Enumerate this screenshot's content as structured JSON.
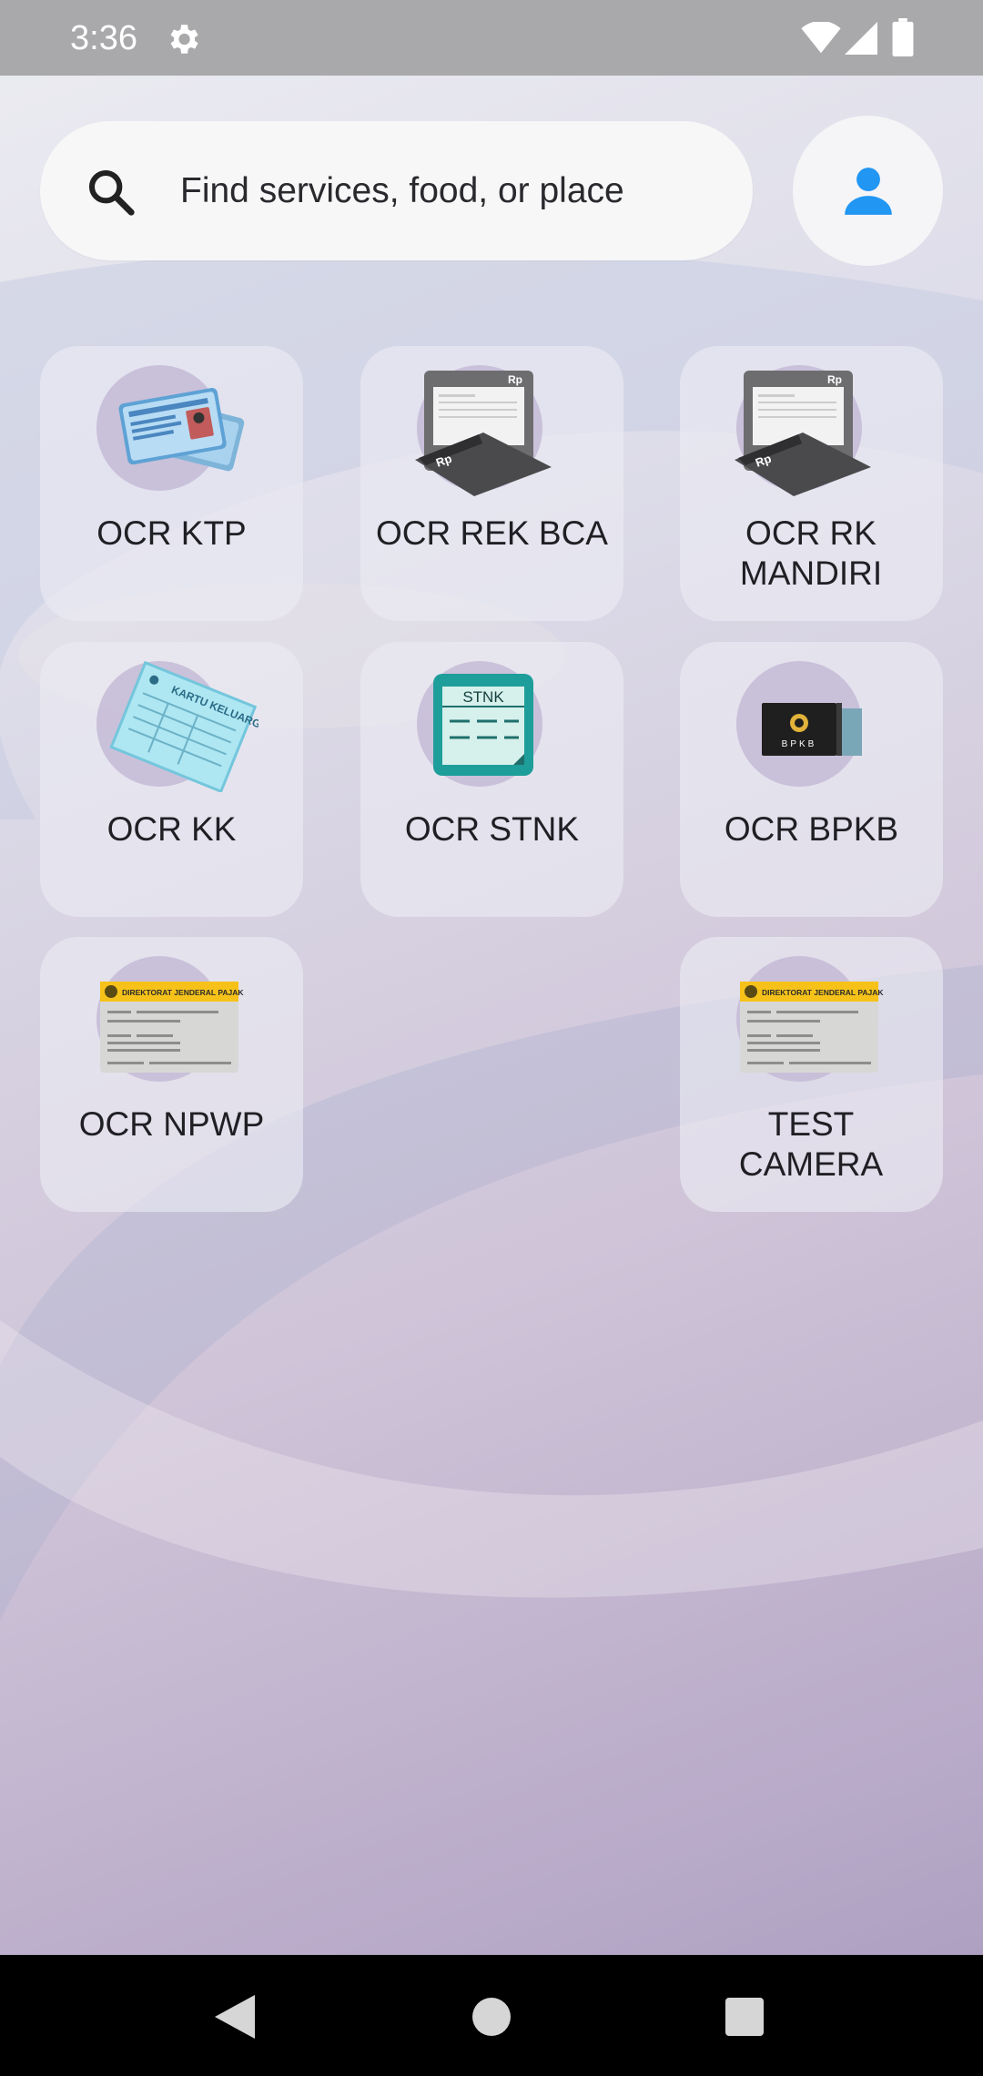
{
  "status_bar": {
    "time": "3:36",
    "icons": [
      "gear-icon",
      "wifi-icon",
      "signal-icon",
      "battery-icon"
    ]
  },
  "search": {
    "placeholder": "Find services, food, or place",
    "icon": "search-icon"
  },
  "profile": {
    "icon": "person-icon",
    "accent": "#2196f3"
  },
  "services": [
    {
      "label": "OCR KTP",
      "icon": "id-card-icon"
    },
    {
      "label": "OCR REK BCA",
      "icon": "bank-statement-icon"
    },
    {
      "label": "OCR RK MANDIRI",
      "icon": "bank-statement-icon"
    },
    {
      "label": "OCR KK",
      "icon": "family-card-icon"
    },
    {
      "label": "OCR STNK",
      "icon": "stnk-icon",
      "art_text": "STNK"
    },
    {
      "label": "OCR BPKB",
      "icon": "bpkb-icon",
      "art_text": "BPKB"
    },
    {
      "label": "OCR NPWP",
      "icon": "npwp-card-icon",
      "art_text": "DIREKTORAT JENDERAL PAJAK"
    },
    {
      "label": "TEST CAMERA",
      "icon": "npwp-card-icon",
      "art_text": "DIREKTORAT JENDERAL PAJAK"
    }
  ],
  "nav_bar": {
    "icons": [
      "back-icon",
      "home-icon",
      "recents-icon"
    ]
  },
  "colors": {
    "status_bar": "#a9a9ab",
    "tile": "#ebebf4",
    "icon_circle": "#c4bad6",
    "stnk_teal": "#1e9e9a",
    "npwp_yellow": "#f6c21a"
  }
}
